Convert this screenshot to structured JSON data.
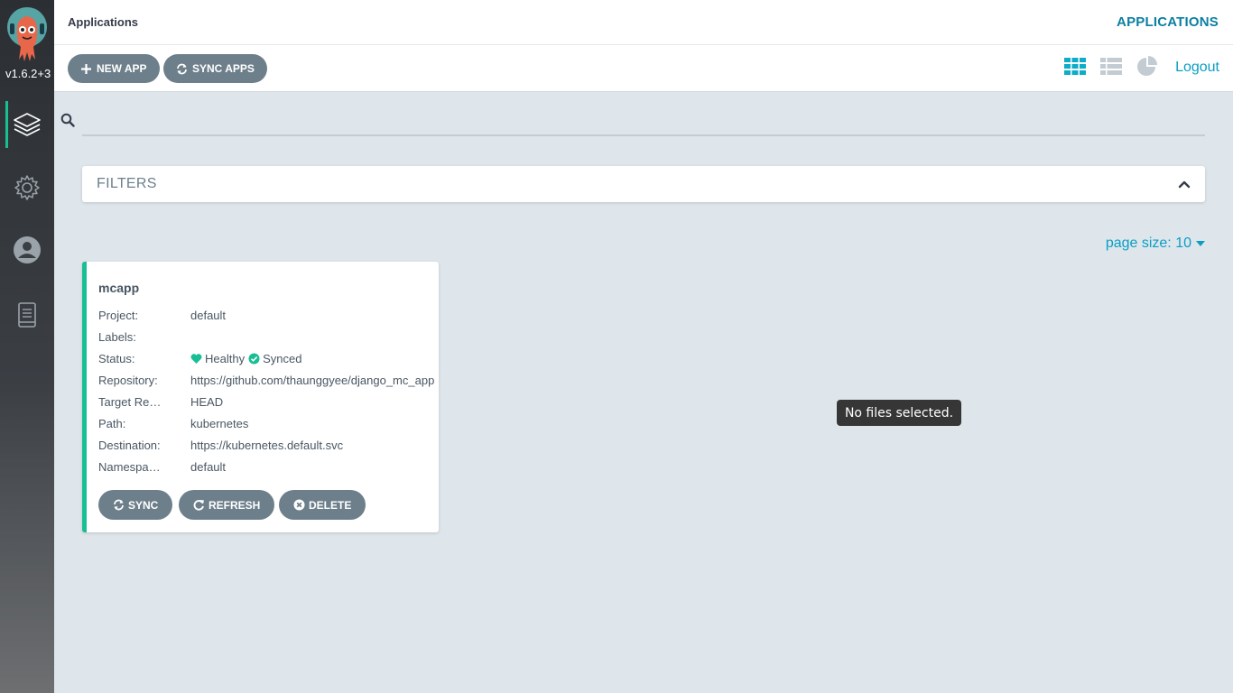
{
  "sidebar": {
    "version": "v1.6.2+3",
    "nav": [
      {
        "name": "applications",
        "icon": "layers-icon",
        "active": true
      },
      {
        "name": "settings",
        "icon": "gear-icon",
        "active": false
      },
      {
        "name": "user-info",
        "icon": "user-icon",
        "active": false
      },
      {
        "name": "docs",
        "icon": "book-icon",
        "active": false
      }
    ]
  },
  "header": {
    "breadcrumb": "Applications",
    "title": "APPLICATIONS"
  },
  "toolbar": {
    "new_app_label": "NEW APP",
    "sync_apps_label": "SYNC APPS",
    "logout_label": "Logout"
  },
  "search": {
    "value": "",
    "placeholder": ""
  },
  "filters": {
    "label": "FILTERS"
  },
  "page_size": {
    "label": "page size: 10"
  },
  "app_card": {
    "name": "mcapp",
    "fields": [
      {
        "label": "Project:",
        "value": "default"
      },
      {
        "label": "Labels:",
        "value": ""
      },
      {
        "label": "Status:",
        "health": "Healthy",
        "sync": "Synced"
      },
      {
        "label": "Repository:",
        "value": "https://github.com/thaunggyee/django_mc_app"
      },
      {
        "label": "Target Revision:",
        "value": "HEAD"
      },
      {
        "label": "Path:",
        "value": "kubernetes"
      },
      {
        "label": "Destination:",
        "value": "https://kubernetes.default.svc"
      },
      {
        "label": "Namespace:",
        "value": "default"
      }
    ],
    "buttons": {
      "sync": "SYNC",
      "refresh": "REFRESH",
      "delete": "DELETE"
    }
  },
  "tooltip": {
    "text": "No files selected."
  },
  "colors": {
    "accent": "#0b9ec4",
    "healthy": "#18be94",
    "button": "#6d7f8b",
    "sidebar": "#2b2f33"
  }
}
